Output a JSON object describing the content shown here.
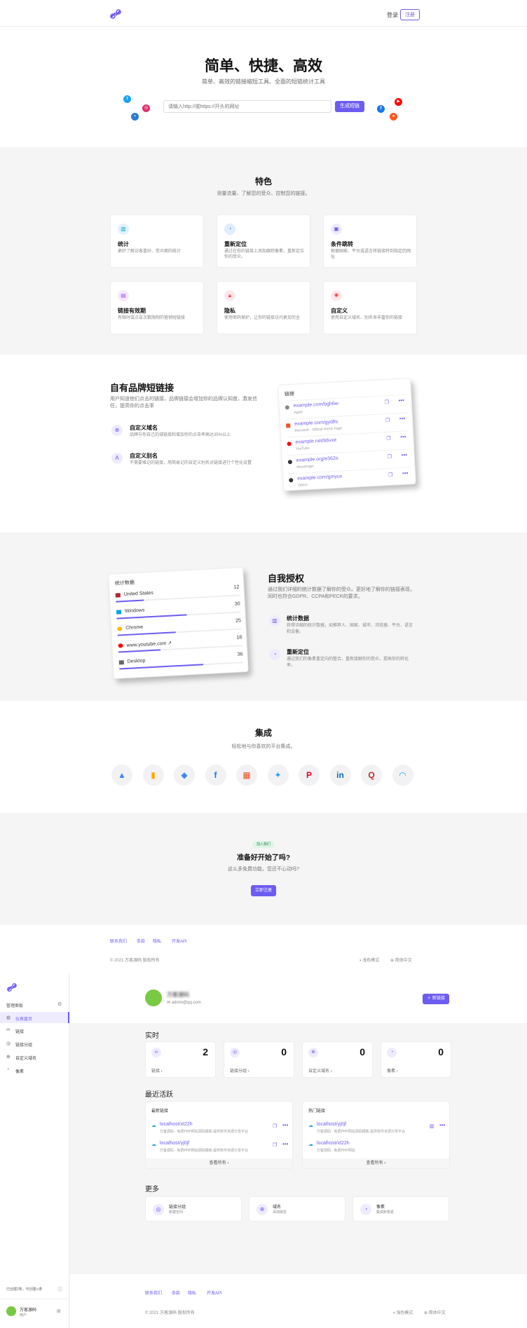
{
  "header": {
    "login": "登录",
    "register": "注册"
  },
  "hero": {
    "title": "简单、快捷、高效",
    "subtitle": "简单、高效的链接缩短工具、全面的短链统计工具",
    "input_placeholder": "请输入http://或https://开头的网址",
    "button": "生成短链"
  },
  "features": {
    "title": "特色",
    "subtitle": "测量流量、了解您的受众、控制您的链接。",
    "items": [
      {
        "title": "统计",
        "desc": "更好了解访客喜好、受众面的统计",
        "icon": "chart-icon"
      },
      {
        "title": "重新定位",
        "desc": "通过在你的链接上添加跟踪像素，重新定位你的受众。",
        "icon": "target-icon"
      },
      {
        "title": "条件跳转",
        "desc": "根据国家、平台或语言将链接转到指定的网址",
        "icon": "redirect-icon"
      },
      {
        "title": "链接有效期",
        "desc": "有限时或点击次数限制的营销短链接",
        "icon": "calendar-icon"
      },
      {
        "title": "隐私",
        "desc": "使用密码保护，让你的链接访问更加完全",
        "icon": "lock-icon"
      },
      {
        "title": "自定义",
        "desc": "使用自定义域名、别名来丰富你的链接",
        "icon": "gear-icon"
      }
    ]
  },
  "brand": {
    "title": "自有品牌短链接",
    "desc": "用户知道他们点击的链接，品牌链接会增加你的品牌认知度，激发信任，提高你的点击率",
    "feat1_title": "自定义域名",
    "feat1_desc": "品牌与你自己的域链接和增加你的点击率高达35%以上",
    "feat2_title": "自定义别名",
    "feat2_desc": "不需要难记的链接，用简易记的自定义别名对链接进行个性化设置",
    "card_title": "链接",
    "links": [
      {
        "url": "example.com/bgh6w",
        "site": "Apple",
        "color": "#888888"
      },
      {
        "url": "example.com/gyd8s",
        "site": "Microsoft - Official Home Page",
        "color": "#f25022"
      },
      {
        "url": "example.net/b6vxe",
        "site": "YouTube",
        "color": "#ff0000"
      },
      {
        "url": "example.org/e362o",
        "site": "Messenger",
        "color": "#333333"
      },
      {
        "url": "example.com/gmyux",
        "site": "Yahoo",
        "color": "#333333"
      }
    ]
  },
  "self": {
    "title": "自我授权",
    "desc": "通过我们详细的统计数据了解你的受众。更好地了解你的链接表现，同时也符合GDPR、CCPA和PECR的要求。",
    "feat1_title": "统计数据",
    "feat1_desc": "获得详细的统计数据，如推荐人、国家、城市、浏览器、平台、语言和设备。",
    "feat2_title": "重新定位",
    "feat2_desc": "通过我们的像素重定向的整合，重新接触你的受众，提高你的转化率。",
    "card_title": "统计数据",
    "stats": [
      {
        "name": "United States",
        "value": "12",
        "fraction": 0.33,
        "color": "#b22234"
      },
      {
        "name": "Windows",
        "value": "30",
        "fraction": 0.83,
        "color": "#00a4ef"
      },
      {
        "name": "Chrome",
        "value": "25",
        "fraction": 0.69,
        "color": "#fbbc05"
      },
      {
        "name": "www.youtube.com ↗",
        "value": "18",
        "fraction": 0.5,
        "color": "#ff0000"
      },
      {
        "name": "Desktop",
        "value": "36",
        "fraction": 1.0,
        "color": "#666666"
      }
    ]
  },
  "integrations": {
    "title": "集成",
    "subtitle": "轻松地与你喜欢的平台集成。",
    "items": [
      {
        "name": "google-ads",
        "glyph": "▲",
        "color": "#4285f4"
      },
      {
        "name": "google-analytics",
        "glyph": "▮",
        "color": "#f9ab00"
      },
      {
        "name": "google-tag-manager",
        "glyph": "◆",
        "color": "#4285f4"
      },
      {
        "name": "facebook",
        "glyph": "f",
        "color": "#1877f2"
      },
      {
        "name": "microsoft",
        "glyph": "▦",
        "color": "#f25022"
      },
      {
        "name": "twitter",
        "glyph": "✦",
        "color": "#1da1f2"
      },
      {
        "name": "pinterest",
        "glyph": "P",
        "color": "#e60023"
      },
      {
        "name": "linkedin",
        "glyph": "in",
        "color": "#0a66c2"
      },
      {
        "name": "quora",
        "glyph": "Q",
        "color": "#b92b27"
      },
      {
        "name": "adroll",
        "glyph": "◠",
        "color": "#16a5e0"
      }
    ]
  },
  "cta": {
    "badge": "加入我们",
    "title": "准备好开始了吗?",
    "subtitle": "这么多免费功能，您还不心动吗?",
    "button": "立即注册"
  },
  "footer": {
    "links": [
      "联系我们",
      "条款",
      "隐私",
      "开发API"
    ],
    "copyright": "© 2021 万客源码 版权所有",
    "theme": "浅色模式",
    "language": "简体中文"
  },
  "dashboard": {
    "sidebar_title": "管理面板",
    "nav": [
      {
        "label": "仪表盘页",
        "icon": "dashboard-icon"
      },
      {
        "label": "链接",
        "icon": "link-icon"
      },
      {
        "label": "链接分组",
        "icon": "group-icon"
      },
      {
        "label": "自定义域名",
        "icon": "globe-icon"
      },
      {
        "label": "像素",
        "icon": "pixel-icon"
      }
    ],
    "usage": "已创建2条，可创建∞条",
    "user_name": "万客源码",
    "user_role": "用户",
    "profile_name": "万客源码",
    "email": "admin@qq.com",
    "new_link": "新链接",
    "realtime": "实时",
    "kpis": [
      {
        "label": "链接",
        "value": "2",
        "icon": "link-icon"
      },
      {
        "label": "链接分组",
        "value": "0",
        "icon": "group-icon"
      },
      {
        "label": "自定义域名",
        "value": "0",
        "icon": "globe-icon"
      },
      {
        "label": "像素",
        "value": "0",
        "icon": "pixel-icon"
      }
    ],
    "recent": "最近活跃",
    "latest_title": "最新链接",
    "hot_title": "热门链接",
    "latest": [
      {
        "url": "localhost/xt22h",
        "desc": "万客源码 - 免费PHP网站源码模板,提供软件资源分享平台"
      },
      {
        "url": "localhost/yj0jf",
        "desc": "万客源码 - 免费PHP网站源码模板,提供软件资源分享平台"
      }
    ],
    "hot": [
      {
        "url": "localhost/yj0jf",
        "desc": "万客源码 - 免费PHP网站源码模板,提供软件资源分享平台"
      },
      {
        "url": "localhost/xt22h",
        "desc": "万客源码 - 免费PHP网站"
      }
    ],
    "view_all": "查看所有",
    "more": "更多",
    "more_items": [
      {
        "title": "链接分组",
        "sub": "新建空间",
        "icon": "group-icon"
      },
      {
        "title": "域名",
        "sub": "添加域名",
        "icon": "globe-icon"
      },
      {
        "title": "像素",
        "sub": "集成新像素",
        "icon": "pixel-icon"
      }
    ],
    "footer_links": [
      "联系我们",
      "条款",
      "隐私",
      "开发API"
    ],
    "footer_copyright": "© 2021 万客源码 版权所有",
    "footer_theme": "浅色模式",
    "footer_language": "简体中文"
  }
}
